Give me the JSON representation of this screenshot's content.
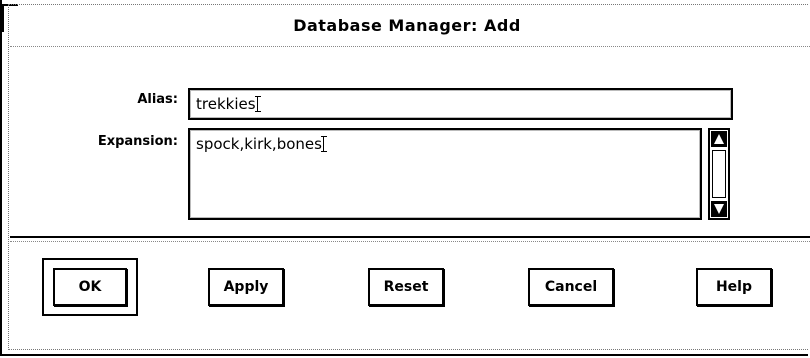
{
  "window": {
    "title": "Database Manager: Add"
  },
  "form": {
    "alias_label": "Alias:",
    "alias_value": "trekkies",
    "expansion_label": "Expansion:",
    "expansion_value": "spock,kirk,bones"
  },
  "buttons": {
    "ok": "OK",
    "apply": "Apply",
    "reset": "Reset",
    "cancel": "Cancel",
    "help": "Help"
  }
}
